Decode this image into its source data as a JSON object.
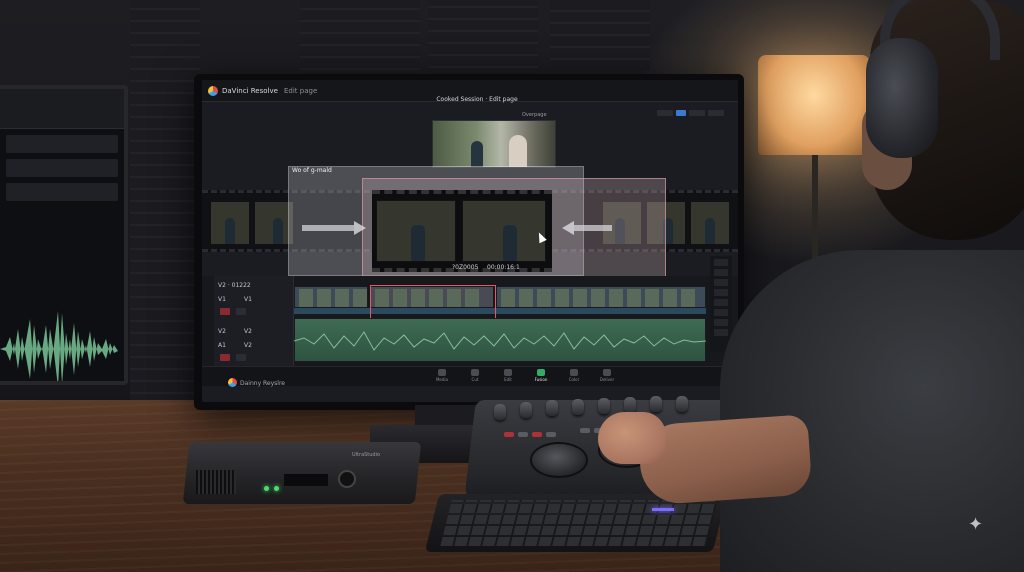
{
  "app": {
    "name": "DaVinci Resolve",
    "page_label": "Edit page",
    "project_title": "Cooked Session · Edit page",
    "viewer_label": "Overpage"
  },
  "overlay": {
    "title": "Wo of g-mald",
    "timecode_a": "?0Z0005",
    "timecode_b": "00:00:16:1"
  },
  "tracks": {
    "header_label": "V2 · 01222",
    "rows": [
      {
        "name": "V1",
        "sub": "V1"
      },
      {
        "name": "V2",
        "sub": "V2"
      },
      {
        "name": "A1",
        "sub": "V2"
      }
    ]
  },
  "pages": [
    {
      "label": "Media",
      "active": false
    },
    {
      "label": "Cut",
      "active": false
    },
    {
      "label": "Edit",
      "active": false
    },
    {
      "label": "Fusion",
      "active": true
    },
    {
      "label": "Color",
      "active": false
    },
    {
      "label": "Deliver",
      "active": false
    }
  ],
  "footer": {
    "brand": "Dainny Reyslre"
  },
  "hardware": {
    "capture_label": "UltraStudio"
  },
  "colors": {
    "accent": "#3a7ad0",
    "active_page": "#2fae6a",
    "clip_selection": "#e05a6a",
    "audio_track": "#3f6b53",
    "led": "#49e06a"
  },
  "icons": {
    "app_logo": "resolve-logo-icon",
    "cursor": "mouse-cursor-icon",
    "sparkle": "sparkle-icon"
  }
}
